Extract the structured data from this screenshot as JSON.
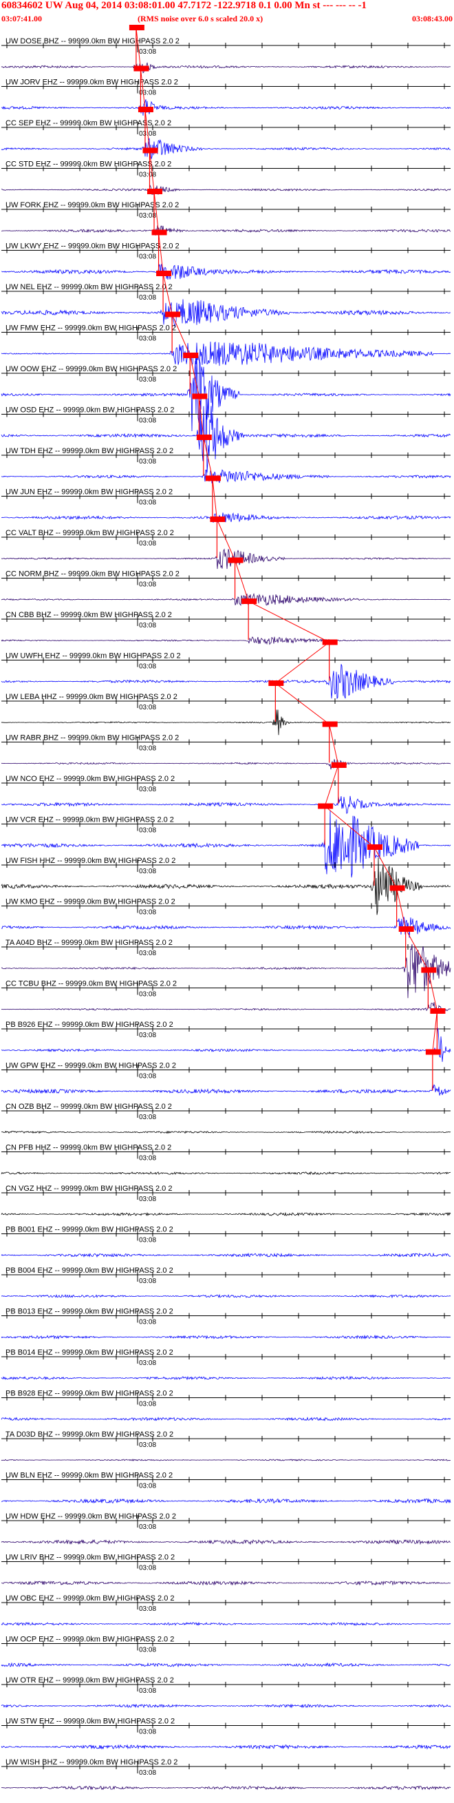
{
  "header": {
    "title": "60834602 UW Aug 04, 2014 03:08:01.00   47.7172 -122.9718  0.1 0.00 Mn st --- --- --   -1",
    "start_time": "03:07:41.00",
    "note": "(RMS noise over 6.0 s scaled 20.0 x)",
    "end_time": "03:08:43.00"
  },
  "colors": {
    "header_text": "#ff0000",
    "pick": "#ff0000",
    "trace_blue": "#0000ff",
    "trace_purple": "#2a006a",
    "trace_black": "#000000",
    "axis": "#000000"
  },
  "chart_data": {
    "type": "seismogram",
    "x_range": [
      "03:07:41.00",
      "03:08:43.00"
    ],
    "minute_marker_label": "03:08",
    "traces": [
      {
        "label": "UW DOSE BHZ -- 99999.0km BW  HIGHPASS  2.0  2",
        "pick": true,
        "color": "purple",
        "event_amp": 0.55,
        "event_at": 0.3,
        "event_len": 0.04,
        "noise": 0.18
      },
      {
        "label": "UW JORV EHZ -- 99999.0km BW  HIGHPASS  2.0  2",
        "pick": true,
        "color": "blue",
        "event_amp": 0.6,
        "event_at": 0.31,
        "event_len": 0.05,
        "noise": 0.2
      },
      {
        "label": "CC SEP EHZ -- 99999.0km BW  HIGHPASS  2.0  2",
        "pick": true,
        "color": "blue",
        "event_amp": 0.7,
        "event_at": 0.32,
        "event_len": 0.1,
        "noise": 0.18
      },
      {
        "label": "CC STD EHZ -- 99999.0km BW  HIGHPASS  2.0  2",
        "pick": true,
        "color": "purple",
        "event_amp": 0.35,
        "event_at": 0.33,
        "event_len": 0.06,
        "noise": 0.15
      },
      {
        "label": "UW FORK EHZ -- 99999.0km BW  HIGHPASS  2.0  2",
        "pick": true,
        "color": "purple",
        "event_amp": 0.35,
        "event_at": 0.34,
        "event_len": 0.06,
        "noise": 0.2
      },
      {
        "label": "UW LKWY EHZ -- 99999.0km BW  HIGHPASS  2.0  2",
        "pick": true,
        "color": "blue",
        "event_amp": 0.55,
        "event_at": 0.35,
        "event_len": 0.15,
        "noise": 0.3
      },
      {
        "label": "UW NEL EHZ -- 99999.0km BW  HIGHPASS  2.0  2",
        "pick": true,
        "color": "blue",
        "event_amp": 0.9,
        "event_at": 0.36,
        "event_len": 0.25,
        "noise": 0.35
      },
      {
        "label": "UW FMW EHZ -- 99999.0km BW  HIGHPASS  2.0  2",
        "pick": true,
        "color": "blue",
        "event_amp": 0.8,
        "event_at": 0.38,
        "event_len": 0.55,
        "noise": 0.08
      },
      {
        "label": "UW OOW EHZ -- 99999.0km BW  HIGHPASS  2.0  2",
        "pick": true,
        "color": "blue",
        "event_amp": 2.6,
        "event_at": 0.42,
        "event_len": 0.08,
        "noise": 0.2
      },
      {
        "label": "UW OSD EHZ -- 99999.0km BW  HIGHPASS  2.0  2",
        "pick": true,
        "color": "blue",
        "event_amp": 2.6,
        "event_at": 0.44,
        "event_len": 0.07,
        "noise": 0.25
      },
      {
        "label": "UW TDH EHZ -- 99999.0km BW  HIGHPASS  2.0  2",
        "pick": true,
        "color": "blue",
        "event_amp": 0.45,
        "event_at": 0.45,
        "event_len": 0.25,
        "noise": 0.2
      },
      {
        "label": "UW JUN EHZ -- 99999.0km BW  HIGHPASS  2.0  2",
        "pick": true,
        "color": "blue",
        "event_amp": 0.35,
        "event_at": 0.47,
        "event_len": 0.15,
        "noise": 0.25
      },
      {
        "label": "CC VALT BHZ -- 99999.0km BW  HIGHPASS  2.0  2",
        "pick": true,
        "color": "purple",
        "event_amp": 0.7,
        "event_at": 0.48,
        "event_len": 0.12,
        "noise": 0.12
      },
      {
        "label": "CC NORM BHZ -- 99999.0km BW  HIGHPASS  2.0  2",
        "pick": true,
        "color": "purple",
        "event_amp": 0.4,
        "event_at": 0.52,
        "event_len": 0.25,
        "noise": 0.1
      },
      {
        "label": "CN CBB BHZ -- 99999.0km BW  HIGHPASS  2.0  2",
        "pick": true,
        "color": "purple",
        "event_amp": 0.25,
        "event_at": 0.55,
        "event_len": 0.2,
        "noise": 0.1
      },
      {
        "label": "UW UWFH EHZ -- 99999.0km BW  HIGHPASS  2.0  2",
        "pick": true,
        "color": "blue",
        "event_amp": 1.2,
        "event_at": 0.73,
        "event_len": 0.12,
        "noise": 0.2
      },
      {
        "label": "UW LEBA HHZ -- 99999.0km BW  HIGHPASS  2.0  2",
        "pick": true,
        "color": "black",
        "event_amp": 1.0,
        "event_at": 0.61,
        "event_len": 0.02,
        "noise": 0.1
      },
      {
        "label": "UW RABR BHZ -- 99999.0km BW  HIGHPASS  2.0  2",
        "pick": true,
        "color": "purple",
        "event_amp": 0.4,
        "event_at": 0.73,
        "event_len": 0.04,
        "noise": 0.12
      },
      {
        "label": "UW NCO EHZ -- 99999.0km BW  HIGHPASS  2.0  2",
        "pick": true,
        "color": "blue",
        "event_amp": 0.6,
        "event_at": 0.75,
        "event_len": 0.08,
        "noise": 0.25
      },
      {
        "label": "UW VCR EHZ -- 99999.0km BW  HIGHPASS  2.0  2",
        "pick": true,
        "color": "blue",
        "event_amp": 2.3,
        "event_at": 0.72,
        "event_len": 0.18,
        "noise": 0.3
      },
      {
        "label": "UW FISH HHZ -- 99999.0km BW  HIGHPASS  2.0  2",
        "pick": true,
        "color": "black",
        "event_amp": 2.0,
        "event_at": 0.83,
        "event_len": 0.08,
        "noise": 0.3
      },
      {
        "label": "UW KMO EHZ -- 99999.0km BW  HIGHPASS  2.0  2",
        "pick": true,
        "color": "blue",
        "event_amp": 0.7,
        "event_at": 0.88,
        "event_len": 0.1,
        "noise": 0.25
      },
      {
        "label": "TA A04D BHZ -- 99999.0km BW  HIGHPASS  2.0  2",
        "pick": true,
        "color": "purple",
        "event_amp": 2.0,
        "event_at": 0.9,
        "event_len": 0.1,
        "noise": 0.15
      },
      {
        "label": "CC TCBU BHZ -- 99999.0km BW  HIGHPASS  2.0  2",
        "pick": true,
        "color": "purple",
        "event_amp": 0.5,
        "event_at": 0.95,
        "event_len": 0.04,
        "noise": 0.12
      },
      {
        "label": "PB B926 EHZ -- 99999.0km BW  HIGHPASS  2.0  2",
        "pick": true,
        "color": "blue",
        "event_amp": 1.6,
        "event_at": 0.97,
        "event_len": 0.02,
        "noise": 0.18
      },
      {
        "label": "UW GPW EHZ -- 99999.0km BW  HIGHPASS  2.0  2",
        "pick": true,
        "color": "blue",
        "event_amp": 0.5,
        "event_at": 0.96,
        "event_len": 0.04,
        "noise": 0.3
      },
      {
        "label": "CN OZB BHZ -- 99999.0km BW  HIGHPASS  2.0  2",
        "pick": false,
        "color": "black",
        "event_amp": 0,
        "event_at": 0,
        "event_len": 0,
        "noise": 0.15
      },
      {
        "label": "CN PFB HHZ -- 99999.0km BW  HIGHPASS  2.0  2",
        "pick": false,
        "color": "black",
        "event_amp": 0,
        "event_at": 0,
        "event_len": 0,
        "noise": 0.18
      },
      {
        "label": "CN VGZ HHZ -- 99999.0km BW  HIGHPASS  2.0  2",
        "pick": false,
        "color": "black",
        "event_amp": 0,
        "event_at": 0,
        "event_len": 0,
        "noise": 0.2
      },
      {
        "label": "PB B001 EHZ -- 99999.0km BW  HIGHPASS  2.0  2",
        "pick": false,
        "color": "blue",
        "event_amp": 0,
        "event_at": 0,
        "event_len": 0,
        "noise": 0.25
      },
      {
        "label": "PB B004 EHZ -- 99999.0km BW  HIGHPASS  2.0  2",
        "pick": false,
        "color": "blue",
        "event_amp": 0,
        "event_at": 0,
        "event_len": 0,
        "noise": 0.2
      },
      {
        "label": "PB B013 EHZ -- 99999.0km BW  HIGHPASS  2.0  2",
        "pick": false,
        "color": "blue",
        "event_amp": 0,
        "event_at": 0,
        "event_len": 0,
        "noise": 0.22
      },
      {
        "label": "PB B014 EHZ -- 99999.0km BW  HIGHPASS  2.0  2",
        "pick": false,
        "color": "blue",
        "event_amp": 0,
        "event_at": 0,
        "event_len": 0,
        "noise": 0.2
      },
      {
        "label": "PB B928 EHZ -- 99999.0km BW  HIGHPASS  2.0  2",
        "pick": false,
        "color": "blue",
        "event_amp": 0,
        "event_at": 0,
        "event_len": 0,
        "noise": 0.22
      },
      {
        "label": "TA D03D BHZ -- 99999.0km BW  HIGHPASS  2.0  2",
        "pick": false,
        "color": "purple",
        "event_amp": 0,
        "event_at": 0,
        "event_len": 0,
        "noise": 0.1
      },
      {
        "label": "UW BLN EHZ -- 99999.0km BW  HIGHPASS  2.0  2",
        "pick": false,
        "color": "blue",
        "event_amp": 0,
        "event_at": 0,
        "event_len": 0,
        "noise": 0.3
      },
      {
        "label": "UW HDW EHZ -- 99999.0km BW  HIGHPASS  2.0  2",
        "pick": false,
        "color": "purple",
        "event_amp": 0,
        "event_at": 0,
        "event_len": 0,
        "noise": 0.3
      },
      {
        "label": "UW LRIV BHZ -- 99999.0km BW  HIGHPASS  2.0  2",
        "pick": false,
        "color": "purple",
        "event_amp": 0,
        "event_at": 0,
        "event_len": 0,
        "noise": 0.28
      },
      {
        "label": "UW OBC EHZ -- 99999.0km BW  HIGHPASS  2.0  2",
        "pick": false,
        "color": "blue",
        "event_amp": 0,
        "event_at": 0,
        "event_len": 0,
        "noise": 0.2
      },
      {
        "label": "UW OCP EHZ -- 99999.0km BW  HIGHPASS  2.0  2",
        "pick": false,
        "color": "blue",
        "event_amp": 0,
        "event_at": 0,
        "event_len": 0,
        "noise": 0.25
      },
      {
        "label": "UW OTR EHZ -- 99999.0km BW  HIGHPASS  2.0  2",
        "pick": false,
        "color": "blue",
        "event_amp": 0,
        "event_at": 0,
        "event_len": 0,
        "noise": 0.22
      },
      {
        "label": "UW STW EHZ -- 99999.0km BW  HIGHPASS  2.0  2",
        "pick": false,
        "color": "blue",
        "event_amp": 0,
        "event_at": 0,
        "event_len": 0,
        "noise": 0.28
      },
      {
        "label": "UW WISH BHZ -- 99999.0km BW  HIGHPASS  2.0  2",
        "pick": false,
        "color": "purple",
        "event_amp": 0,
        "event_at": 0,
        "event_len": 0,
        "noise": 0.25
      }
    ]
  }
}
